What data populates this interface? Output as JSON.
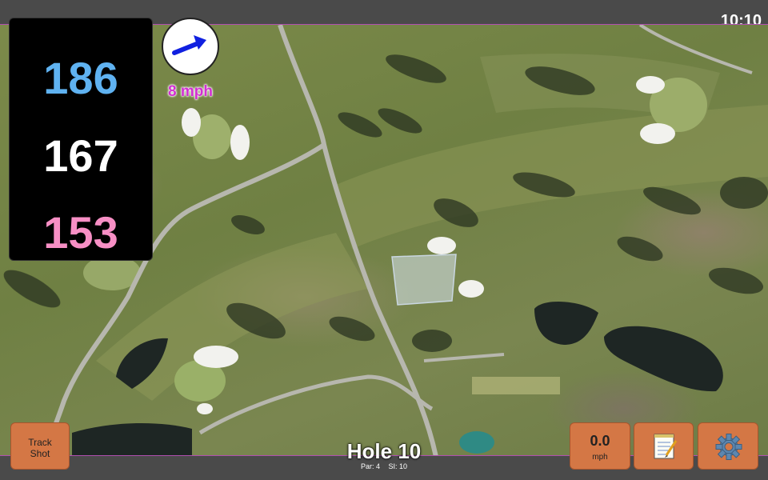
{
  "status": {
    "time": "10:10"
  },
  "distances": {
    "back": "186",
    "center": "167",
    "front": "153"
  },
  "wind": {
    "speed_label": "8 mph",
    "icon": "arrow-icon",
    "arrow_color": "#1020e0"
  },
  "hole": {
    "title": "Hole 10",
    "par": "Par: 4",
    "si": "SI: 10"
  },
  "buttons": {
    "track_shot_line1": "Track",
    "track_shot_line2": "Shot",
    "speed_value": "0.0",
    "speed_unit": "mph",
    "notes_icon": "notepad-icon",
    "settings_icon": "gear-icon"
  },
  "colors": {
    "back_distance": "#5fb2f1",
    "center_distance": "#ffffff",
    "front_distance": "#f78fc5",
    "button": "#d47745",
    "wind_label": "#d22fd2"
  }
}
